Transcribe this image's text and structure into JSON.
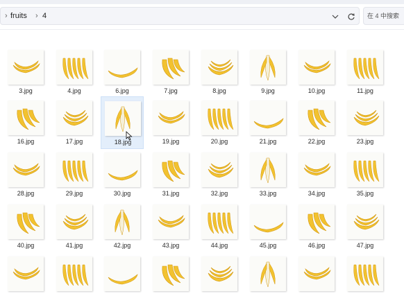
{
  "breadcrumb": {
    "items": [
      "fruits",
      "4"
    ]
  },
  "search": {
    "placeholder": "在 4 中搜索"
  },
  "icons": {
    "dropdown": "chevron-down-icon",
    "refresh": "refresh-icon",
    "folder_arrow": "chevron-right-icon"
  },
  "colors": {
    "banana": "#f2c230",
    "banana_dark": "#d49a12",
    "selection": "#e3eefb"
  },
  "rows": [
    [
      "3.jpg",
      "4.jpg",
      "6.jpg",
      "7.jpg",
      "8.jpg",
      "9.jpg",
      "10.jpg",
      "11.jpg"
    ],
    [
      "16.jpg",
      "17.jpg",
      "18.jpg",
      "19.jpg",
      "20.jpg",
      "21.jpg",
      "22.jpg",
      "23.jpg"
    ],
    [
      "28.jpg",
      "29.jpg",
      "30.jpg",
      "31.jpg",
      "32.jpg",
      "33.jpg",
      "34.jpg",
      "35.jpg"
    ],
    [
      "40.jpg",
      "41.jpg",
      "42.jpg",
      "43.jpg",
      "44.jpg",
      "45.jpg",
      "46.jpg",
      "47.jpg"
    ],
    [
      "",
      "",
      "",
      "",
      "",
      "",
      "",
      ""
    ]
  ],
  "selected_file": "18.jpg"
}
